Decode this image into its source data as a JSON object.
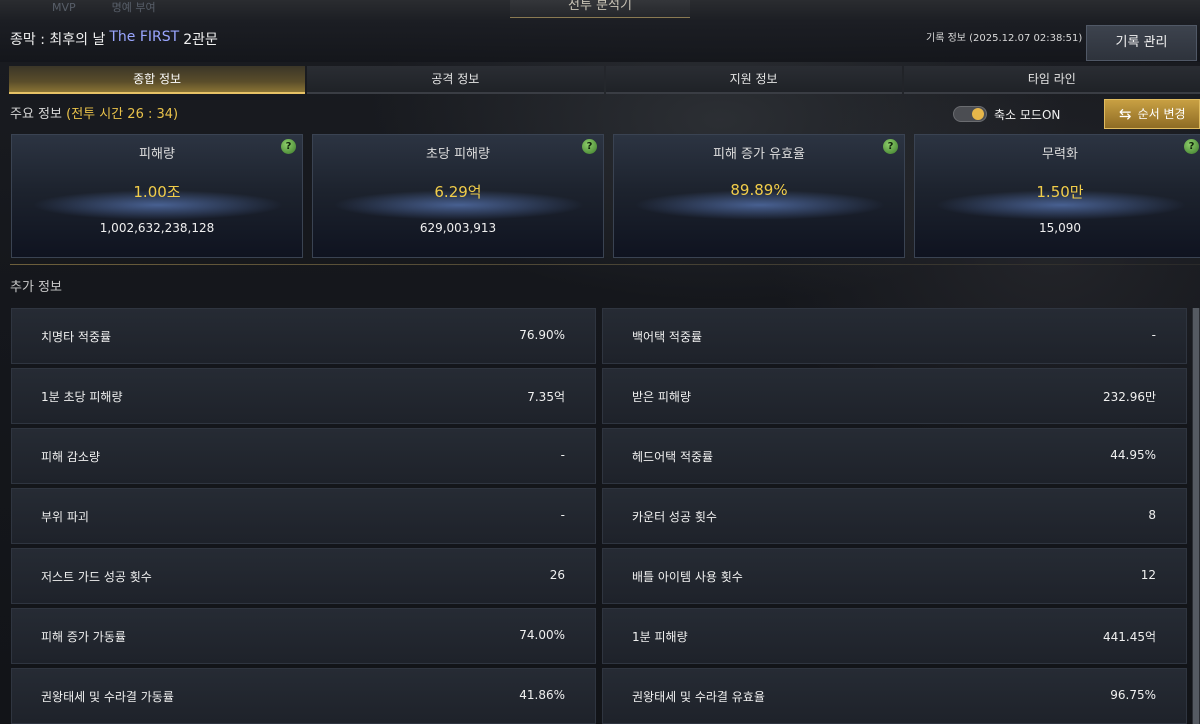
{
  "window": {
    "title": "전투 분석기"
  },
  "top_tabs": [
    "MVP",
    "명예 부여"
  ],
  "header": {
    "stage_prefix": "종막 : 최후의 날",
    "stage_highlight": "The FIRST",
    "stage_suffix": "2관문",
    "record_info": "기록 정보 (2025.12.07 02:38:51)",
    "record_button": "기록 관리"
  },
  "tabs": [
    {
      "label": "종합 정보",
      "active": true
    },
    {
      "label": "공격 정보",
      "active": false
    },
    {
      "label": "지원 정보",
      "active": false
    },
    {
      "label": "타임 라인",
      "active": false
    }
  ],
  "main_info": {
    "label": "주요 정보",
    "battle_time": "(전투 시간 26 : 34)"
  },
  "toggle": {
    "label": "축소 모드ON",
    "on": true
  },
  "order_button": {
    "label": "순서 변경"
  },
  "cards": [
    {
      "title": "피해량",
      "value": "1.00조",
      "detail": "1,002,632,238,128"
    },
    {
      "title": "초당 피해량",
      "value": "6.29억",
      "detail": "629,003,913"
    },
    {
      "title": "피해 증가 유효율",
      "value": "89.89%",
      "detail": ""
    },
    {
      "title": "무력화",
      "value": "1.50만",
      "detail": "15,090"
    }
  ],
  "extra": {
    "title": "추가 정보",
    "left": [
      {
        "label": "치명타 적중률",
        "value": "76.90%"
      },
      {
        "label": "1분 초당 피해량",
        "value": "7.35억"
      },
      {
        "label": "피해 감소량",
        "value": "-"
      },
      {
        "label": "부위 파괴",
        "value": "-"
      },
      {
        "label": "저스트 가드 성공 횟수",
        "value": "26"
      },
      {
        "label": "피해 증가 가동률",
        "value": "74.00%"
      },
      {
        "label": "권왕태세 및 수라결 가동률",
        "value": "41.86%"
      }
    ],
    "right": [
      {
        "label": "백어택 적중률",
        "value": "-"
      },
      {
        "label": "받은 피해량",
        "value": "232.96만"
      },
      {
        "label": "헤드어택 적중률",
        "value": "44.95%"
      },
      {
        "label": "카운터 성공 횟수",
        "value": "8"
      },
      {
        "label": "배틀 아이템 사용 횟수",
        "value": "12"
      },
      {
        "label": "1분 피해량",
        "value": "441.45억"
      },
      {
        "label": "권왕태세 및 수라결 유효율",
        "value": "96.75%"
      }
    ]
  },
  "colors": {
    "accent_gold": "#e9c24a",
    "stage_highlight": "#9aa6ff",
    "help_green": "#6fb24d"
  },
  "icons": {
    "help": "question-icon",
    "order": "swap-arrows-icon"
  }
}
